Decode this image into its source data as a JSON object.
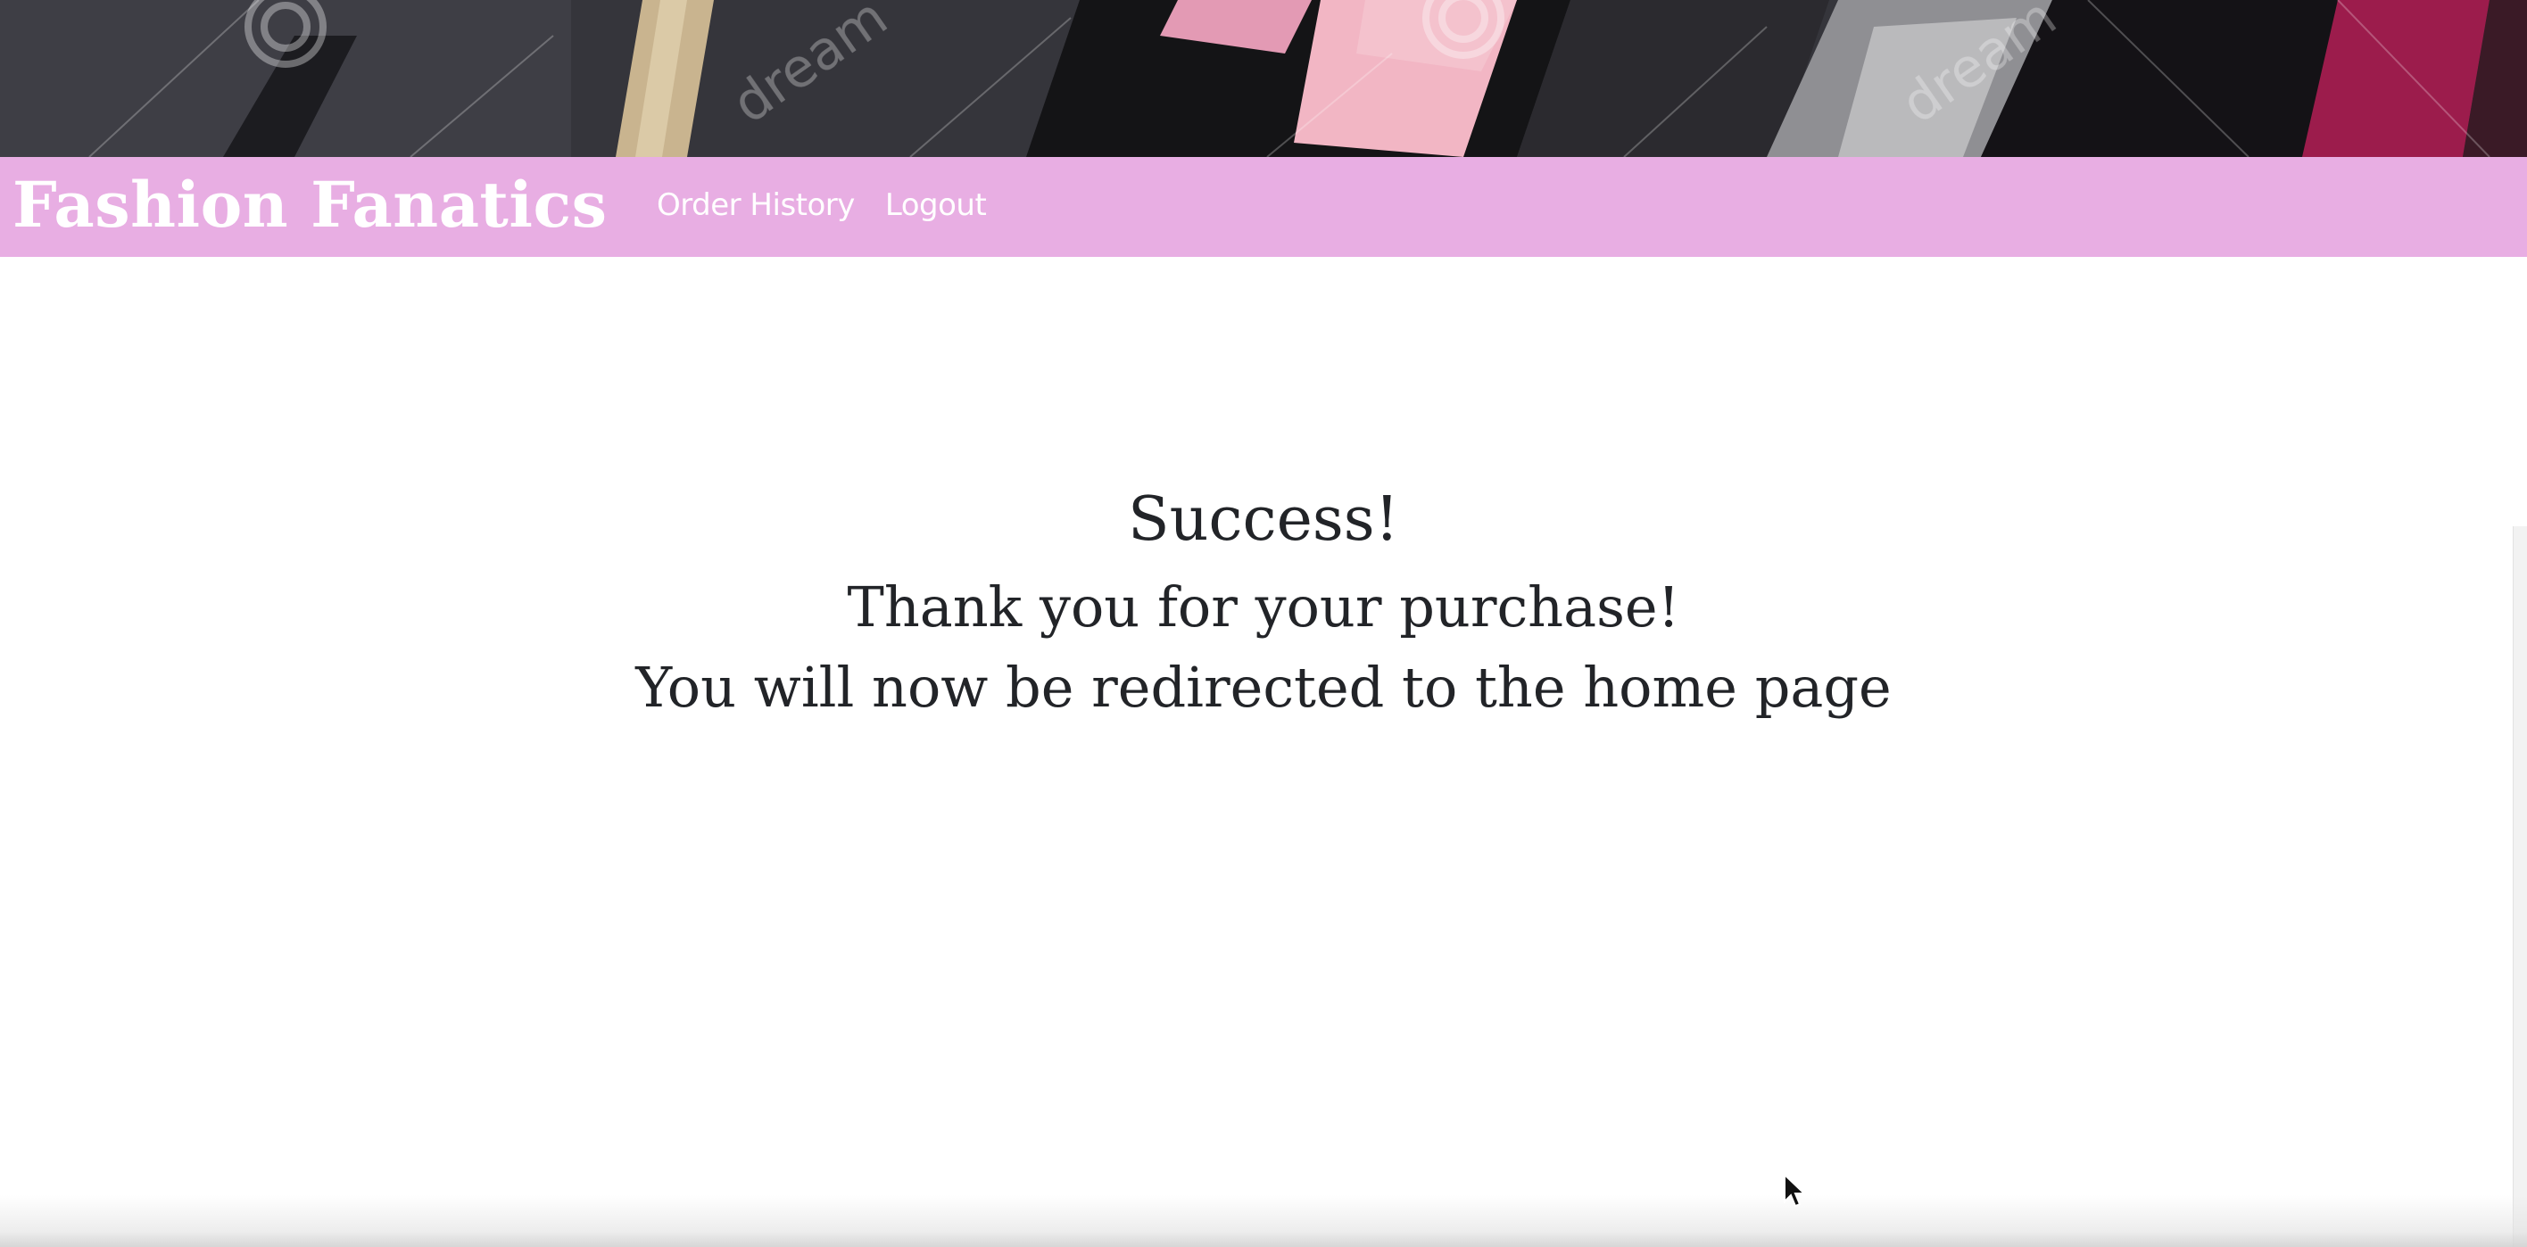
{
  "brand": {
    "name": "Fashion Fanatics"
  },
  "nav": {
    "links": [
      {
        "label": "Order History"
      },
      {
        "label": "Logout"
      }
    ]
  },
  "message": {
    "title": "Success!",
    "line1": "Thank you for your purchase!",
    "line2": "You will now be redirected to the home page"
  },
  "colors": {
    "navbar_bg": "#e8aee3",
    "brand_text": "#ffffff",
    "body_text": "#222428",
    "page_bg": "#ffffff"
  },
  "icons": {
    "cursor": "arrow-cursor-icon"
  }
}
